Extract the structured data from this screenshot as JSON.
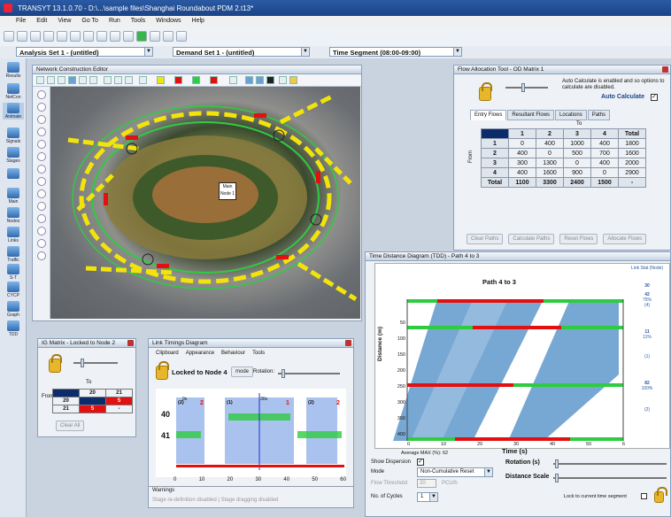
{
  "app": {
    "title": "TRANSYT 13.1.0.70 - D:\\...\\sample files\\Shanghai Roundabout PDM 2.t13*"
  },
  "menu": [
    "File",
    "Edit",
    "View",
    "Go To",
    "Run",
    "Tools",
    "Windows",
    "Help"
  ],
  "selectors": {
    "analysis": "Analysis Set 1 - (untitled)",
    "demand": "Demand Set 1 - (untitled)",
    "time": "Time Segment (08:00-09:00)"
  },
  "sidebar": [
    "Results",
    "NetCon",
    "Animate",
    "Signals",
    "Stages",
    "Main",
    "Nodes",
    "Links",
    "Traffic",
    "S-T",
    "CYCP",
    "Graph",
    "TDD"
  ],
  "network": {
    "title": "Network Construction Editor",
    "node_label": "Main Node 1"
  },
  "flow": {
    "title": "Flow Allocation Tool - OD Matrix 1",
    "auto_calc_note": "Auto Calculate is enabled and so options to calculate are disabled.",
    "auto_calc_label": "Auto Calculate",
    "tabs": [
      "Entry Flows",
      "Resultant Flows",
      "Locations",
      "Paths"
    ],
    "to_label": "To",
    "from_label": "From",
    "columns": [
      "",
      "1",
      "2",
      "3",
      "4",
      "Total"
    ],
    "rows": [
      [
        "1",
        "0",
        "400",
        "1000",
        "400",
        "1800"
      ],
      [
        "2",
        "400",
        "0",
        "500",
        "700",
        "1600"
      ],
      [
        "3",
        "300",
        "1300",
        "0",
        "400",
        "2000"
      ],
      [
        "4",
        "400",
        "1600",
        "900",
        "0",
        "2900"
      ],
      [
        "Total",
        "1100",
        "3300",
        "2400",
        "1500",
        "-"
      ]
    ],
    "buttons": [
      "Clear Paths",
      "Calculate Paths",
      "Reset Flows",
      "Allocate Flows"
    ]
  },
  "ig": {
    "title": "IG Matrix - Locked to Node 2",
    "to_label": "To",
    "from_label": "From",
    "header": [
      "",
      "20",
      "21"
    ],
    "rows": [
      [
        "20",
        "",
        "5"
      ],
      [
        "21",
        "5",
        "-"
      ]
    ],
    "clear_label": "Clear All"
  },
  "ltd": {
    "title": "Link Timings Diagram",
    "menu": [
      "Clipboard",
      "Appearance",
      "Behaviour",
      "Tools"
    ],
    "locked_label": "Locked to Node 4",
    "mode_label": "mode",
    "rotation_label": "Rotation:",
    "stage_boxes": [
      "(2)",
      "2",
      "(1)",
      "1",
      "(2)",
      "2"
    ],
    "rows": [
      "40",
      "41"
    ],
    "ticks": [
      "0",
      "10",
      "20",
      "30",
      "40",
      "50",
      "60"
    ],
    "mark_labels": [
      "0s",
      "30s"
    ],
    "warnings_label": "Warnings",
    "status": "Stage re-definition disabled | Stage dragging disabled"
  },
  "tdd": {
    "title": "Time Distance Diagram (TDD) - Path 4 to 3",
    "chart_title": "Path 4 to 3",
    "ylabel": "Distance (m)",
    "xlabel": "Time (s)",
    "yticks": [
      "50",
      "100",
      "150",
      "200",
      "250",
      "300",
      "350",
      "400",
      "450"
    ],
    "xticks": [
      "0",
      "10",
      "20",
      "30",
      "40",
      "50",
      "6"
    ],
    "right_header": "Link Stat (Node)",
    "right_labels": [
      "30",
      "42",
      "75%",
      "(4)",
      "11",
      "11%",
      "(1)",
      "82",
      "100%",
      "(2)"
    ],
    "avg_label": "Average MAX (%):",
    "avg_value": "62",
    "show_dispersion": "Show Dispersion",
    "mode_label": "Mode",
    "mode_value": "Non-Cumulative Reset",
    "flow_threshold": "Flow Threshold",
    "flow_value": "20",
    "flow_unit": "PCU/h",
    "cycles_label": "No. of Cycles",
    "cycles_value": "1",
    "rotation_label": "Rotation (s)",
    "distance_scale": "Distance Scale",
    "lock_label": "Lock to current time segment"
  },
  "colors": {
    "accent": "#1b4488",
    "green": "#2ecc40",
    "red": "#e21010",
    "yellow": "#f2e40a",
    "blue": "#3f7fc0"
  }
}
